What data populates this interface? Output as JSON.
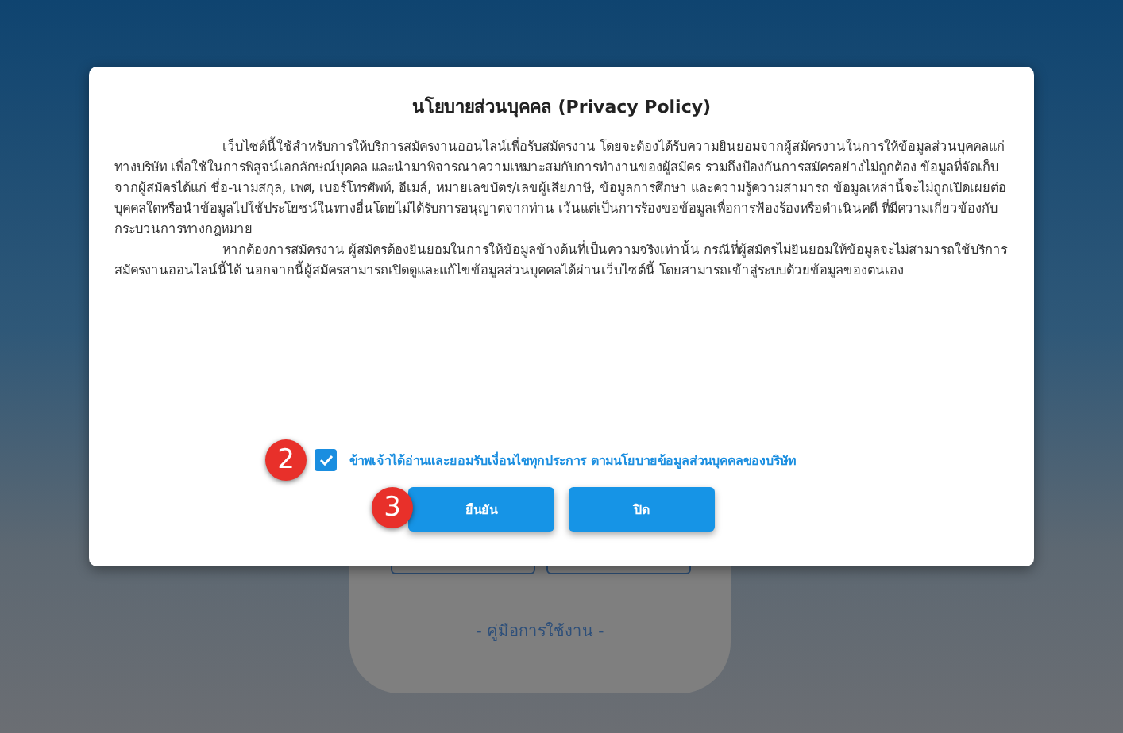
{
  "background_card": {
    "link": "- คู่มือการใช้งาน -"
  },
  "dialog": {
    "title": "นโยบายส่วนบุคคล (Privacy Policy)",
    "paragraphs": [
      "เว็บไซต์นี้ใช้สำหรับการให้บริการสมัครงานออนไลน์เพื่อรับสมัครงาน โดยจะต้องได้รับความยินยอมจากผู้สมัครงานในการให้ข้อมูลส่วนบุคคลแก่ทางบริษัท เพื่อใช้ในการพิสูจน์เอกลักษณ์บุคคล และนำมาพิจารณาความเหมาะสมกับการทำงานของผู้สมัคร รวมถึงป้องกันการสมัครอย่างไม่ถูกต้อง ข้อมูลที่จัดเก็บจากผู้สมัครได้แก่ ชื่อ-นามสกุล, เพศ, เบอร์โทรศัพท์, อีเมล์, หมายเลขบัตร/เลขผู้เสียภาษี, ข้อมูลการศึกษา และความรู้ความสามารถ ข้อมูลเหล่านี้จะไม่ถูกเปิดเผยต่อบุคคลใดหรือนำข้อมูลไปใช้ประโยชน์ในทางอื่นโดยไม่ได้รับการอนุญาตจากท่าน เว้นแต่เป็นการร้องขอข้อมูลเพื่อการฟ้องร้องหรือดำเนินคดี ที่มีความเกี่ยวข้องกับกระบวนการทางกฎหมาย",
      "หากต้องการสมัครงาน ผู้สมัครต้องยินยอมในการให้ข้อมูลข้างต้นที่เป็นความจริงเท่านั้น กรณีที่ผู้สมัครไม่ยินยอมให้ข้อมูลจะไม่สามารถใช้บริการสมัครงานออนไลน์นี้ได้ นอกจากนี้ผู้สมัครสามารถเปิดดูและแก้ไขข้อมูลส่วนบุคคลได้ผ่านเว็บไซต์นี้ โดยสามารถเข้าสู่ระบบด้วยข้อมูลของตนเอง"
    ],
    "consent": {
      "label": "ข้าพเจ้าได้อ่านและยอมรับเงื่อนไขทุกประการ ตามนโยบายข้อมูลส่วนบุคคลของบริษัท",
      "checked": true,
      "step_badge": "2"
    },
    "buttons": [
      {
        "label": "ยืนยัน",
        "step_badge": "3"
      },
      {
        "label": "ปิด"
      }
    ]
  }
}
